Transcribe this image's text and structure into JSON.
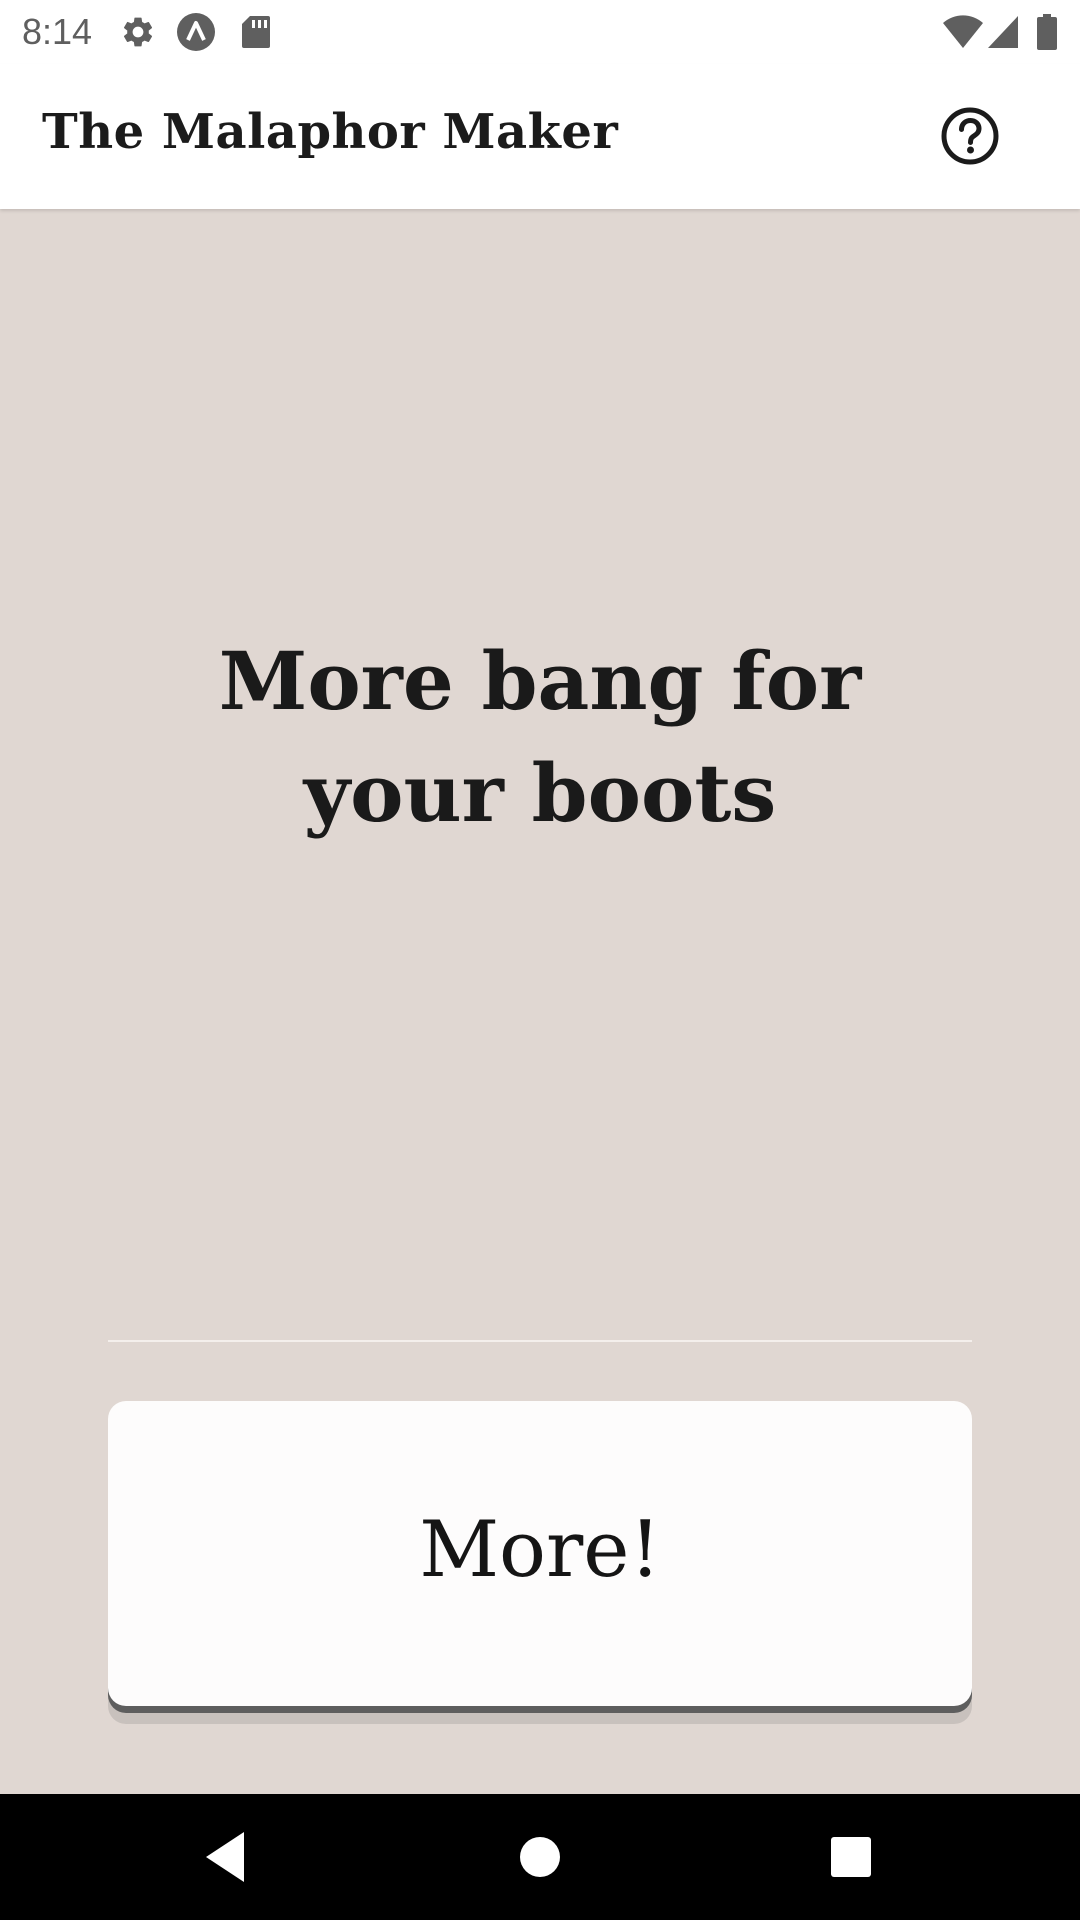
{
  "status_bar": {
    "time": "8:14",
    "left_icons": [
      "settings-icon",
      "app-notification-icon",
      "sd-card-icon"
    ],
    "right_icons": [
      "wifi-icon",
      "cell-signal-icon",
      "battery-icon"
    ]
  },
  "app_bar": {
    "title": "The Malaphor Maker",
    "help_icon": "help-circle-icon"
  },
  "main": {
    "malaphor": "More bang for your boots",
    "button_label": "More!"
  },
  "nav_bar": {
    "buttons": [
      "back-icon",
      "home-icon",
      "recents-icon"
    ]
  },
  "colors": {
    "background": "#e0d7d2",
    "surface": "#ffffff",
    "text": "#1a1a1a",
    "button_edge": "#5e5e5e"
  }
}
